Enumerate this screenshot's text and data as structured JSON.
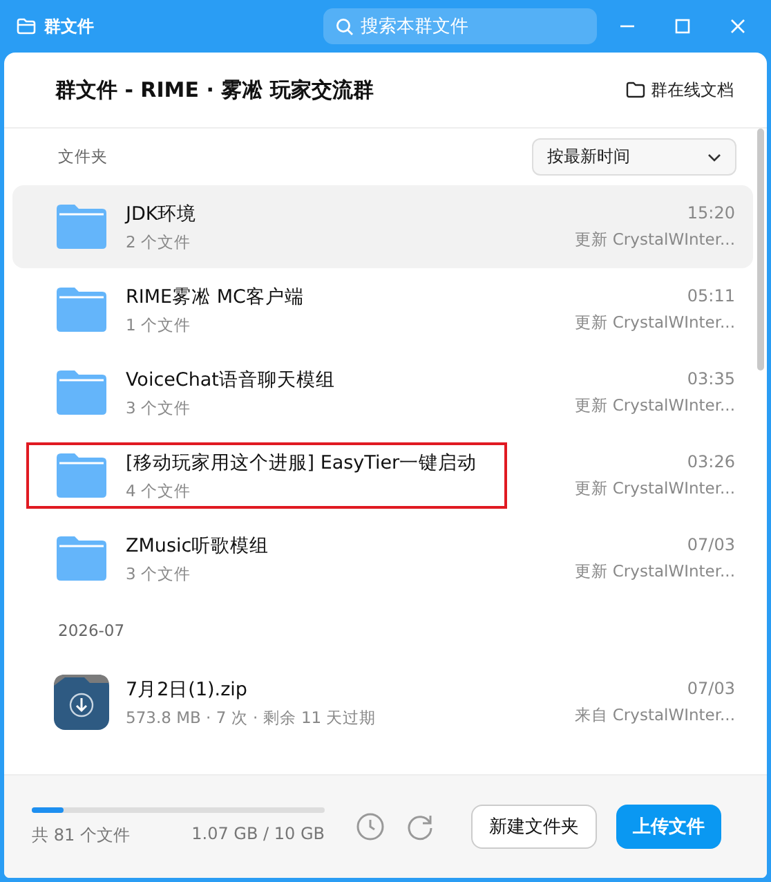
{
  "window": {
    "title": "群文件"
  },
  "search": {
    "placeholder": "搜索本群文件"
  },
  "header": {
    "title": "群文件 - RIME · 雾凇 玩家交流群",
    "online_docs": "群在线文档"
  },
  "folder_section": {
    "label": "文件夹",
    "sort": "按最新时间"
  },
  "folders": [
    {
      "name": "JDK环境",
      "count": "2 个文件",
      "time": "15:20",
      "updater": "更新 CrystalWInter...",
      "selected": true,
      "highlighted": false
    },
    {
      "name": "RIME雾凇 MC客户端",
      "count": "1 个文件",
      "time": "05:11",
      "updater": "更新 CrystalWInter...",
      "selected": false,
      "highlighted": false
    },
    {
      "name": "VoiceChat语音聊天模组",
      "count": "3 个文件",
      "time": "03:35",
      "updater": "更新 CrystalWInter...",
      "selected": false,
      "highlighted": false
    },
    {
      "name": "[移动玩家用这个进服] EasyTier一键启动",
      "count": "4 个文件",
      "time": "03:26",
      "updater": "更新 CrystalWInter...",
      "selected": false,
      "highlighted": true
    },
    {
      "name": "ZMusic听歌模组",
      "count": "3 个文件",
      "time": "07/03",
      "updater": "更新 CrystalWInter...",
      "selected": false,
      "highlighted": false
    }
  ],
  "file_section": {
    "label": "2026-07"
  },
  "files": [
    {
      "name": "7月2日(1).zip",
      "meta": "573.8 MB · 7 次 · 剩余 11 天过期",
      "time": "07/03",
      "from": "来自 CrystalWInter..."
    }
  ],
  "footer": {
    "count": "共 81 个文件",
    "usage": "1.07 GB / 10 GB",
    "level": 0.11,
    "new_folder": "新建文件夹",
    "upload": "上传文件"
  }
}
